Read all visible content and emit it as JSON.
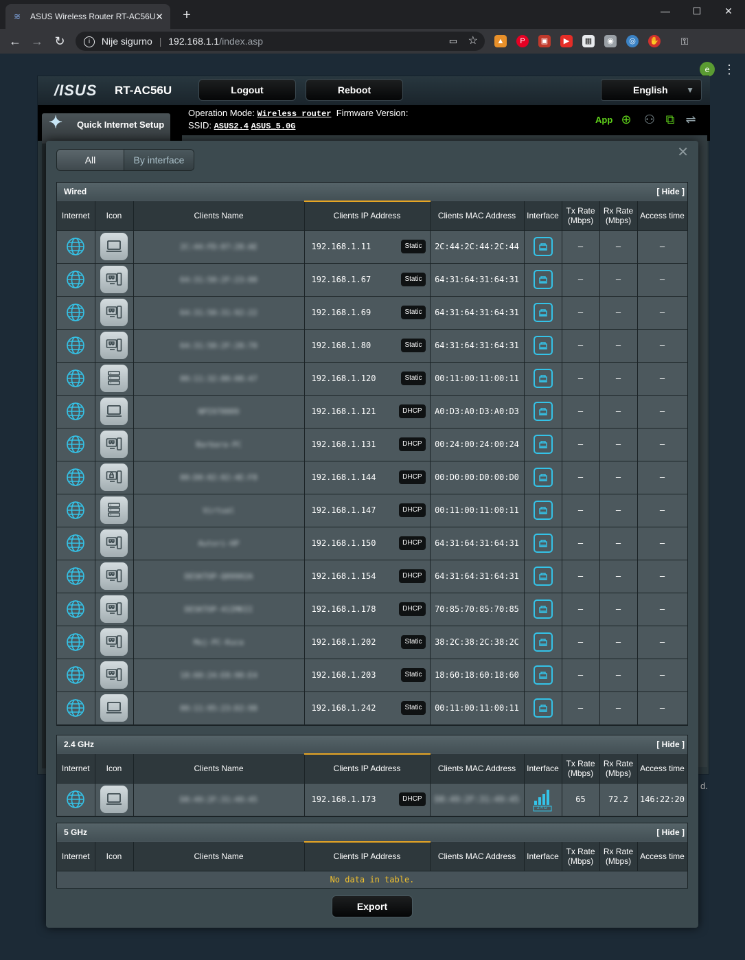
{
  "browser": {
    "tab_title": "ASUS Wireless Router RT-AC56U",
    "not_secure": "Nije sigurno",
    "url_host": "192.168.1.1",
    "url_path": "/index.asp",
    "profile_initial": "e"
  },
  "router": {
    "brand": "/ISUS",
    "model": "RT-AC56U",
    "logout_label": "Logout",
    "reboot_label": "Reboot",
    "language": "English",
    "op_mode_label": "Operation Mode:",
    "op_mode_value": "Wireless router",
    "firmware_label": "Firmware Version:",
    "ssid_label": "SSID:",
    "ssid_24": "ASUS2.4",
    "ssid_5": "ASUS_5.0G",
    "app_label": "App",
    "qis_label": "Quick Internet Setup",
    "trailing_char": "d."
  },
  "modal": {
    "tab_all": "All",
    "tab_by_interface": "By interface",
    "hide_label": "[ Hide ]",
    "export_label": "Export",
    "no_data": "No data in table.",
    "columns": {
      "internet": "Internet",
      "icon": "Icon",
      "name": "Clients Name",
      "ip": "Clients IP Address",
      "mac": "Clients MAC Address",
      "interface": "Interface",
      "tx": "Tx Rate (Mbps)",
      "rx": "Rx Rate (Mbps)",
      "access": "Access time"
    },
    "sections": {
      "wired": "Wired",
      "ghz24": "2.4 GHz",
      "ghz5": "5 GHz"
    },
    "wired_clients": [
      {
        "device": "laptop",
        "name": "2C:44:FD:07:28:AE",
        "ip": "192.168.1.11",
        "type": "Static",
        "mac": "2C:44:2C:44:2C:44",
        "tx": "–",
        "rx": "–",
        "access": "–"
      },
      {
        "device": "windows",
        "name": "64:31:50:2F:23:00",
        "ip": "192.168.1.67",
        "type": "Static",
        "mac": "64:31:64:31:64:31",
        "tx": "–",
        "rx": "–",
        "access": "–"
      },
      {
        "device": "windows",
        "name": "64:31:50:31:92:22",
        "ip": "192.168.1.69",
        "type": "Static",
        "mac": "64:31:64:31:64:31",
        "tx": "–",
        "rx": "–",
        "access": "–"
      },
      {
        "device": "windows",
        "name": "64:31:50:2F:28:70",
        "ip": "192.168.1.80",
        "type": "Static",
        "mac": "64:31:64:31:64:31",
        "tx": "–",
        "rx": "–",
        "access": "–"
      },
      {
        "device": "server",
        "name": "00:11:32:80:08:47",
        "ip": "192.168.1.120",
        "type": "Static",
        "mac": "00:11:00:11:00:11",
        "tx": "–",
        "rx": "–",
        "access": "–"
      },
      {
        "device": "laptop",
        "name": "NPI970009",
        "ip": "192.168.1.121",
        "type": "DHCP",
        "mac": "A0:D3:A0:D3:A0:D3",
        "tx": "–",
        "rx": "–",
        "access": "–"
      },
      {
        "device": "windows",
        "name": "Barbara-PC",
        "ip": "192.168.1.131",
        "type": "DHCP",
        "mac": "00:24:00:24:00:24",
        "tx": "–",
        "rx": "–",
        "access": "–"
      },
      {
        "device": "lockpc",
        "name": "00:D0:02:02:4E:F8",
        "ip": "192.168.1.144",
        "type": "DHCP",
        "mac": "00:D0:00:D0:00:D0",
        "tx": "–",
        "rx": "–",
        "access": "–"
      },
      {
        "device": "server",
        "name": "Virtual",
        "ip": "192.168.1.147",
        "type": "DHCP",
        "mac": "00:11:00:11:00:11",
        "tx": "–",
        "rx": "–",
        "access": "–"
      },
      {
        "device": "windows",
        "name": "Autori-HP",
        "ip": "192.168.1.150",
        "type": "DHCP",
        "mac": "64:31:64:31:64:31",
        "tx": "–",
        "rx": "–",
        "access": "–"
      },
      {
        "device": "windows",
        "name": "DESKTOP-Q09902A",
        "ip": "192.168.1.154",
        "type": "DHCP",
        "mac": "64:31:64:31:64:31",
        "tx": "–",
        "rx": "–",
        "access": "–"
      },
      {
        "device": "windows",
        "name": "DESKTOP-41IMKII",
        "ip": "192.168.1.178",
        "type": "DHCP",
        "mac": "70:85:70:85:70:85",
        "tx": "–",
        "rx": "–",
        "access": "–"
      },
      {
        "device": "windows",
        "name": "Moj-PC-Kuca",
        "ip": "192.168.1.202",
        "type": "Static",
        "mac": "38:2C:38:2C:38:2C",
        "tx": "–",
        "rx": "–",
        "access": "–"
      },
      {
        "device": "windows",
        "name": "18:60:24:E8:90:E4",
        "ip": "192.168.1.203",
        "type": "Static",
        "mac": "18:60:18:60:18:60",
        "tx": "–",
        "rx": "–",
        "access": "–"
      },
      {
        "device": "laptop",
        "name": "00:11:95:23:D2:98",
        "ip": "192.168.1.242",
        "type": "Static",
        "mac": "00:11:00:11:00:11",
        "tx": "–",
        "rx": "–",
        "access": "–"
      }
    ],
    "ghz24_clients": [
      {
        "device": "laptop",
        "name": "D8:49:2F:31:49:45",
        "ip": "192.168.1.173",
        "type": "DHCP",
        "mac": "D8:49:2F:31:49:45",
        "iface_label": "2.4 G",
        "tx": "65",
        "rx": "72.2",
        "access": "146:22:20"
      }
    ]
  },
  "colors": {
    "accent": "#34c3e8",
    "app_green": "#5fd11a",
    "ip_header_accent": "#e8a624",
    "no_data_text": "#f2c12e"
  }
}
